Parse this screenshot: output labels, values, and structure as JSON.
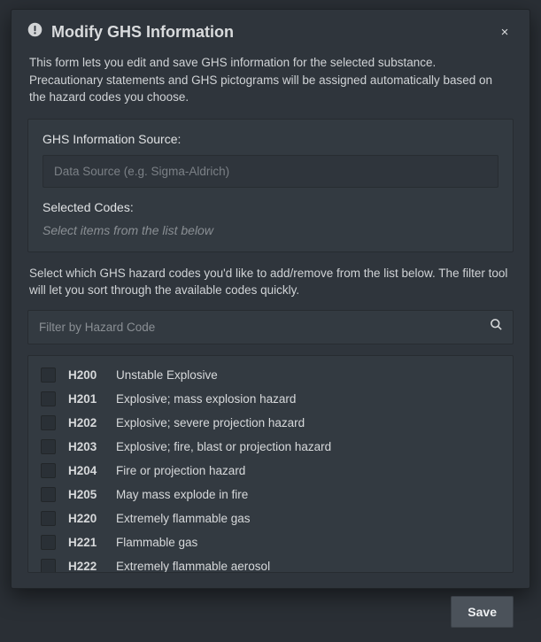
{
  "modal": {
    "title": "Modify GHS Information",
    "intro": "This form lets you edit and save GHS information for the selected substance. Precautionary statements and GHS pictograms will be assigned automatically based on the hazard codes you choose.",
    "close_label": "×"
  },
  "source": {
    "label": "GHS Information Source:",
    "placeholder": "Data Source (e.g. Sigma-Aldrich)",
    "value": ""
  },
  "selected": {
    "label": "Selected Codes:",
    "empty_text": "Select items from the list below"
  },
  "hint": "Select which GHS hazard codes you'd like to add/remove from the list below. The filter tool will let you sort through the available codes quickly.",
  "filter": {
    "placeholder": "Filter by Hazard Code",
    "value": ""
  },
  "codes": [
    {
      "code": "H200",
      "desc": "Unstable Explosive"
    },
    {
      "code": "H201",
      "desc": "Explosive; mass explosion hazard"
    },
    {
      "code": "H202",
      "desc": "Explosive; severe projection hazard"
    },
    {
      "code": "H203",
      "desc": "Explosive; fire, blast or projection hazard"
    },
    {
      "code": "H204",
      "desc": "Fire or projection hazard"
    },
    {
      "code": "H205",
      "desc": "May mass explode in fire"
    },
    {
      "code": "H220",
      "desc": "Extremely flammable gas"
    },
    {
      "code": "H221",
      "desc": "Flammable gas"
    },
    {
      "code": "H222",
      "desc": "Extremely flammable aerosol"
    }
  ],
  "footer": {
    "save_label": "Save"
  }
}
